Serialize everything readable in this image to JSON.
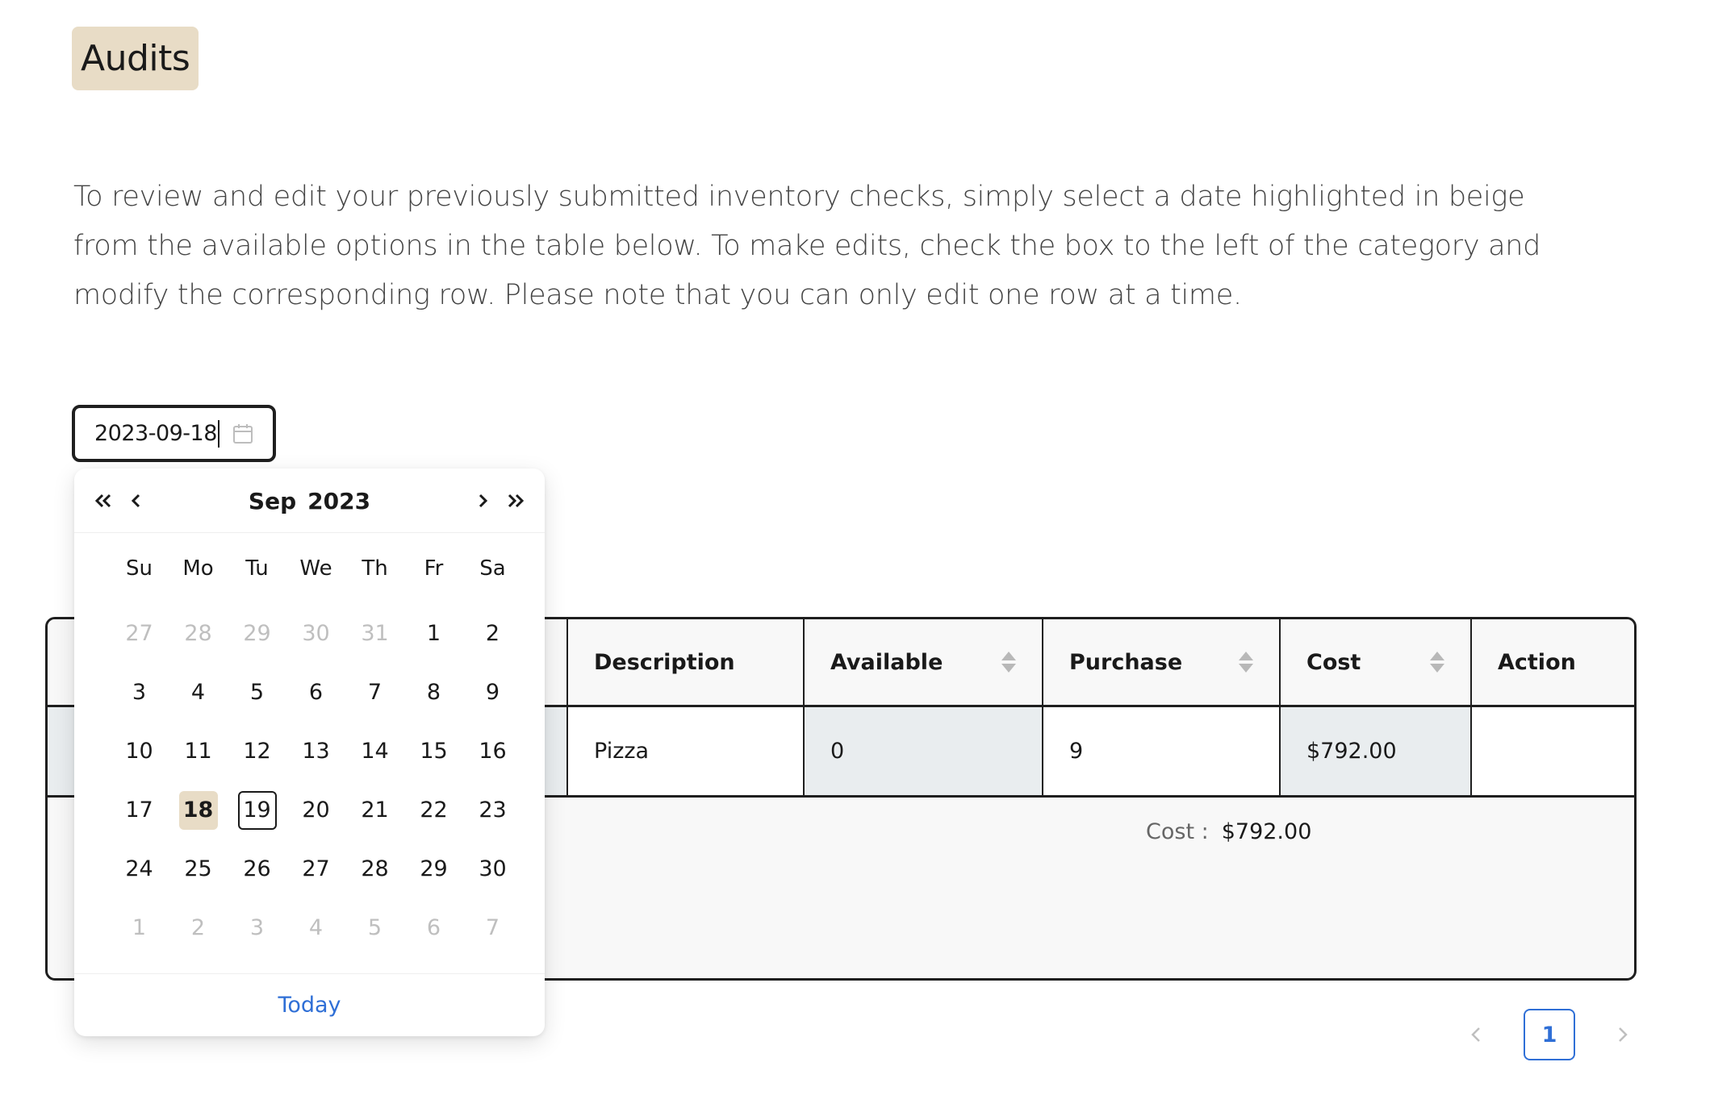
{
  "page": {
    "title": "Audits",
    "description": "To review and edit your previously submitted inventory checks, simply select a date highlighted in beige from the available options in the table below. To make edits, check the box to the left of the category and modify the corresponding row. Please note that you can only edit one row at a time."
  },
  "date_picker": {
    "value": "2023-09-18",
    "icon": "calendar-icon"
  },
  "calendar": {
    "month": "Sep",
    "year": "2023",
    "weekdays": [
      "Su",
      "Mo",
      "Tu",
      "We",
      "Th",
      "Fr",
      "Sa"
    ],
    "days": [
      {
        "d": "27",
        "muted": true
      },
      {
        "d": "28",
        "muted": true
      },
      {
        "d": "29",
        "muted": true
      },
      {
        "d": "30",
        "muted": true
      },
      {
        "d": "31",
        "muted": true
      },
      {
        "d": "1"
      },
      {
        "d": "2"
      },
      {
        "d": "3"
      },
      {
        "d": "4"
      },
      {
        "d": "5"
      },
      {
        "d": "6"
      },
      {
        "d": "7"
      },
      {
        "d": "8"
      },
      {
        "d": "9"
      },
      {
        "d": "10"
      },
      {
        "d": "11"
      },
      {
        "d": "12"
      },
      {
        "d": "13"
      },
      {
        "d": "14"
      },
      {
        "d": "15"
      },
      {
        "d": "16"
      },
      {
        "d": "17"
      },
      {
        "d": "18",
        "selected": true
      },
      {
        "d": "19",
        "today": true
      },
      {
        "d": "20"
      },
      {
        "d": "21"
      },
      {
        "d": "22"
      },
      {
        "d": "23"
      },
      {
        "d": "24"
      },
      {
        "d": "25"
      },
      {
        "d": "26"
      },
      {
        "d": "27"
      },
      {
        "d": "28"
      },
      {
        "d": "29"
      },
      {
        "d": "30"
      },
      {
        "d": "1",
        "muted": true
      },
      {
        "d": "2",
        "muted": true
      },
      {
        "d": "3",
        "muted": true
      },
      {
        "d": "4",
        "muted": true
      },
      {
        "d": "5",
        "muted": true
      },
      {
        "d": "6",
        "muted": true
      },
      {
        "d": "7",
        "muted": true
      }
    ],
    "today_label": "Today"
  },
  "table": {
    "columns": [
      {
        "label": "Description",
        "sortable": false
      },
      {
        "label": "Available",
        "sortable": true
      },
      {
        "label": "Purchase",
        "sortable": true
      },
      {
        "label": "Cost",
        "sortable": true
      },
      {
        "label": "Action",
        "sortable": false
      }
    ],
    "rows": [
      {
        "description": "Pizza",
        "available": "0",
        "purchase": "9",
        "cost": "$792.00",
        "action": ""
      }
    ],
    "summary": {
      "label": "Cost :",
      "amount": "$792.00"
    }
  },
  "pagination": {
    "current_page": "1"
  },
  "colors": {
    "accent_beige": "#e8dcc6",
    "link_blue": "#2f6fd6",
    "border_dark": "#1f1f1f",
    "shaded_cell": "#e9edef"
  }
}
